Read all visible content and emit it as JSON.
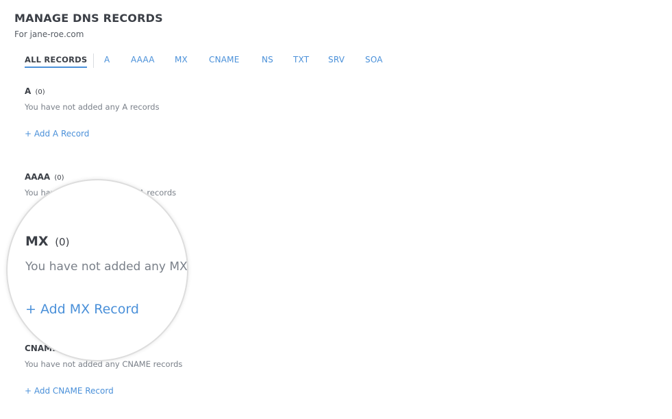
{
  "header": {
    "title": "MANAGE DNS RECORDS",
    "subtitle": "For jane-roe.com"
  },
  "tabs": [
    {
      "label": "ALL RECORDS",
      "active": true
    },
    {
      "label": "A",
      "active": false
    },
    {
      "label": "AAAA",
      "active": false
    },
    {
      "label": "MX",
      "active": false
    },
    {
      "label": "CNAME",
      "active": false
    },
    {
      "label": "NS",
      "active": false
    },
    {
      "label": "TXT",
      "active": false
    },
    {
      "label": "SRV",
      "active": false
    },
    {
      "label": "SOA",
      "active": false
    }
  ],
  "sections": {
    "a": {
      "type": "A",
      "count": "(0)",
      "empty_message": "You have not added any A records",
      "add_label": "+ Add A Record"
    },
    "aaaa": {
      "type": "AAAA",
      "count": "(0)",
      "empty_message": "You have not added any AAAA records"
    },
    "mx": {
      "type": "MX",
      "count": "(0)",
      "empty_message": "You have not added any MX",
      "add_label": "+ Add MX Record"
    },
    "cname": {
      "type": "CNAME",
      "empty_message": "You have not added any CNAME records",
      "add_label": "+ Add CNAME Record"
    }
  },
  "colors": {
    "accent": "#4a90d9",
    "heading": "#3b3f46",
    "muted": "#7a8089"
  }
}
